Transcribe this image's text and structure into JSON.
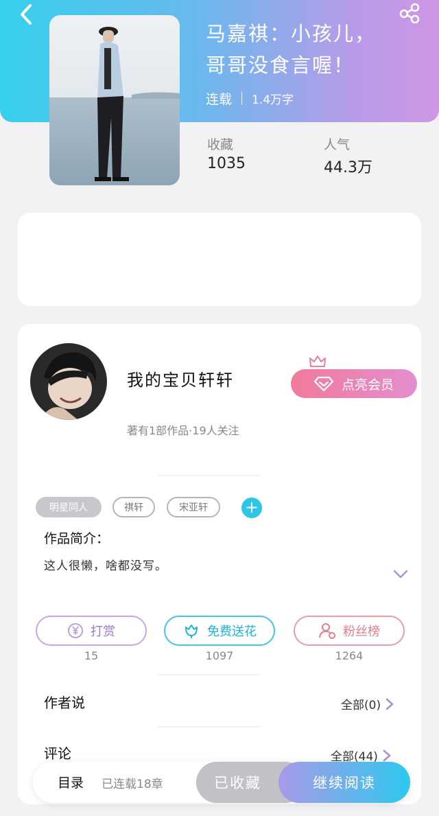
{
  "colors": {
    "header_gradient_start": "#36d0ee",
    "header_gradient_end": "#cf96e4",
    "vip_gradient_start": "#f27a9b",
    "vip_gradient_end": "#e48ecf",
    "continue_gradient_start": "#a99ae8",
    "continue_gradient_end": "#2ec8ee",
    "tag_add": "#2ec6e8"
  },
  "header": {
    "back_icon": "chevron-left-icon",
    "share_icon": "share-icon"
  },
  "book": {
    "title_line1": "马嘉祺：小孩儿，",
    "title_line2": "哥哥没食言喔！",
    "status": "连载",
    "word_count": "1.4万字",
    "stats": {
      "favorites_label": "收藏",
      "favorites_value": "1035",
      "popularity_label": "人气",
      "popularity_value": "44.3万"
    }
  },
  "author": {
    "name": "我的宝贝轩轩",
    "meta": "著有1部作品·19人关注",
    "vip_button": "点亮会员"
  },
  "tags": [
    "明星同人",
    "祺轩",
    "宋亚轩"
  ],
  "tag_add_label": "+",
  "intro": {
    "label": "作品简介：",
    "text": "这人很懒，啥都没写。"
  },
  "actions": {
    "reward": {
      "label": "打赏",
      "count": "15",
      "icon": "yuan-icon"
    },
    "flower": {
      "label": "免费送花",
      "count": "1097",
      "icon": "flower-icon"
    },
    "fans": {
      "label": "粉丝榜",
      "count": "1264",
      "icon": "user-icon"
    }
  },
  "author_says": {
    "title": "作者说",
    "link": "全部(0)"
  },
  "comments": {
    "title": "评论",
    "link": "全部(44)"
  },
  "bottom_bar": {
    "toc": "目录",
    "chapter_status": "已连载18章",
    "favorited": "已收藏",
    "continue": "继续阅读"
  }
}
